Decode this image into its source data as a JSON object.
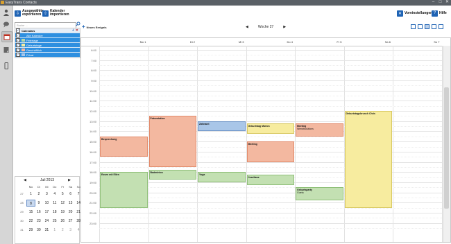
{
  "app": {
    "title": "EasyTrans Contacts"
  },
  "toolbar": {
    "export_label_1": "Ausgewählte",
    "export_label_2": "exportieren",
    "import_label_1": "Kalender",
    "import_label_2": "importieren",
    "settings_label": "Voreinstellungen",
    "help_label": "Hilfe"
  },
  "sidebar": {
    "search_placeholder": "Suche ...",
    "calendars_header": "Calendars",
    "calendars": [
      {
        "label": "Alle Kalender",
        "color": "#2e8fe0"
      },
      {
        "label": "Feiertage",
        "color": "#b7d7a8"
      },
      {
        "label": "Geburtstage",
        "color": "#f7ec9f"
      },
      {
        "label": "Geschäftlich",
        "color": "#f3b8a0"
      },
      {
        "label": "Privat",
        "color": "#a9c6e8"
      }
    ]
  },
  "minical": {
    "month_label": "Juli 2013",
    "dow": [
      "Mo",
      "Di",
      "Mi",
      "Do",
      "Fr",
      "Sa",
      "So"
    ],
    "weeks": [
      "27",
      "28",
      "29",
      "30",
      "31"
    ],
    "rows": [
      [
        "1",
        "2",
        "3",
        "4",
        "5",
        "6",
        "7"
      ],
      [
        "8",
        "9",
        "10",
        "11",
        "12",
        "13",
        "14"
      ],
      [
        "15",
        "16",
        "17",
        "18",
        "19",
        "20",
        "21"
      ],
      [
        "22",
        "23",
        "24",
        "25",
        "26",
        "27",
        "28"
      ],
      [
        "29",
        "30",
        "31",
        "1",
        "2",
        "3",
        "4"
      ]
    ]
  },
  "main": {
    "new_event_label": "Neues Ereignis",
    "week_label": "Woche 27",
    "days": [
      "Mo 1",
      "Di 2",
      "Mi 3",
      "Do 4",
      "Fr 5",
      "Sa 6",
      "So 7"
    ],
    "hours": [
      "6:00",
      "7:00",
      "8:00",
      "9:00",
      "10:00",
      "11:00",
      "12:00",
      "13:00",
      "14:00",
      "15:00",
      "16:00",
      "17:00",
      "18:00",
      "19:00",
      "20:00",
      "21:00",
      "22:00",
      "23:00"
    ]
  },
  "events": [
    {
      "title": "Besprechung",
      "day": 0,
      "start": 14.5,
      "end": 16.5,
      "color": "#f3b8a0",
      "border": "#e28a6a"
    },
    {
      "title": "Essen mit Ellen",
      "day": 0,
      "start": 18.0,
      "end": 21.5,
      "color": "#c3e0b2",
      "border": "#8fbf78"
    },
    {
      "title": "Präsentation",
      "day": 1,
      "start": 12.5,
      "end": 17.5,
      "color": "#f3b8a0",
      "border": "#e28a6a"
    },
    {
      "title": "Badminton",
      "day": 1,
      "start": 17.75,
      "end": 18.75,
      "color": "#c3e0b2",
      "border": "#8fbf78"
    },
    {
      "title": "Zahnarzt",
      "day": 2,
      "start": 13.0,
      "end": 14.0,
      "color": "#a9c6e8",
      "border": "#6f96c8"
    },
    {
      "title": "Yoga",
      "day": 2,
      "start": 18.0,
      "end": 19.0,
      "color": "#c3e0b2",
      "border": "#8fbf78"
    },
    {
      "title": "Geburtstag Marion",
      "day": 3,
      "start": 13.25,
      "end": 14.25,
      "color": "#f7ec9f",
      "border": "#d8c860"
    },
    {
      "title": "Meeting",
      "day": 3,
      "start": 15.0,
      "end": 17.0,
      "color": "#f3b8a0",
      "border": "#e28a6a"
    },
    {
      "title": "Joseliana",
      "day": 3,
      "start": 18.25,
      "end": 19.25,
      "color": "#c3e0b2",
      "border": "#8fbf78"
    },
    {
      "title": "Meeting",
      "subtitle": "Wendtsolutions",
      "day": 4,
      "start": 13.25,
      "end": 14.5,
      "color": "#f3b8a0",
      "border": "#e28a6a"
    },
    {
      "title": "Geburtsparty",
      "subtitle": "Gueta",
      "day": 4,
      "start": 19.5,
      "end": 20.75,
      "color": "#c3e0b2",
      "border": "#8fbf78"
    },
    {
      "title": "Geburtstagsbrunch Chris",
      "day": 5,
      "start": 12.0,
      "end": 21.5,
      "color": "#f7ec9f",
      "border": "#d8c860"
    }
  ]
}
